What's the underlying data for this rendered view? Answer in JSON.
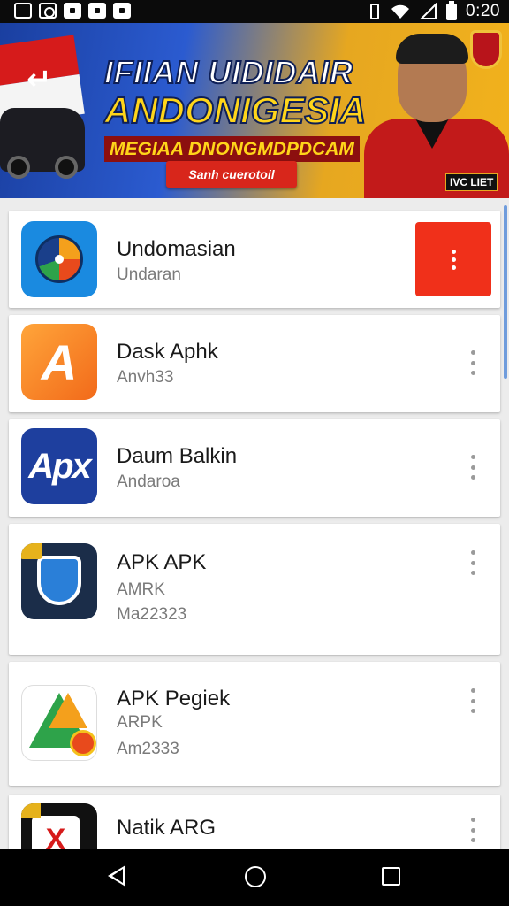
{
  "status_bar": {
    "time": "0:20",
    "left_icons": [
      "gallery-icon",
      "instagram-icon",
      "file-icon",
      "bag-icon",
      "bag-icon"
    ],
    "right_icons": [
      "vibrate-icon",
      "wifi-icon",
      "signal-icon",
      "battery-icon"
    ]
  },
  "banner": {
    "line1": "IFIIAN UIDIDAIR",
    "line2": "ANDONIGESIA",
    "line3": "MEGIAA DNONGMDPDCAM",
    "button_label": "Sanh cuerotoil",
    "patch_text": "IVC LIET",
    "colors": {
      "blue": "#1a3fa0",
      "yellow": "#ffd51a",
      "red": "#d8261b"
    }
  },
  "apps": [
    {
      "name": "Undomasian",
      "sub1": "Undaran",
      "sub2": "",
      "icon": "color-wheel-icon",
      "menu_highlight": true
    },
    {
      "name": "Dask Aphk",
      "sub1": "Anvh33",
      "sub2": "",
      "icon": "orange-a-icon",
      "icon_text": "A",
      "menu_highlight": false
    },
    {
      "name": "Daum Balkin",
      "sub1": "Andaroa",
      "sub2": "",
      "icon": "apx-icon",
      "icon_text": "Apx",
      "menu_highlight": false
    },
    {
      "name": "APK APK",
      "sub1": "AMRK",
      "sub2": "Ma22323",
      "icon": "shield-icon",
      "menu_highlight": false
    },
    {
      "name": "APK Pegiek",
      "sub1": "ARPK",
      "sub2": "Am2333",
      "icon": "triangle-mascot-icon",
      "menu_highlight": false
    },
    {
      "name": "Natik ARG",
      "sub1": "",
      "sub2": "",
      "icon": "x-badge-icon",
      "icon_text": "X",
      "menu_highlight": false
    }
  ],
  "navbar": {
    "buttons": [
      "back",
      "home",
      "recents"
    ]
  }
}
